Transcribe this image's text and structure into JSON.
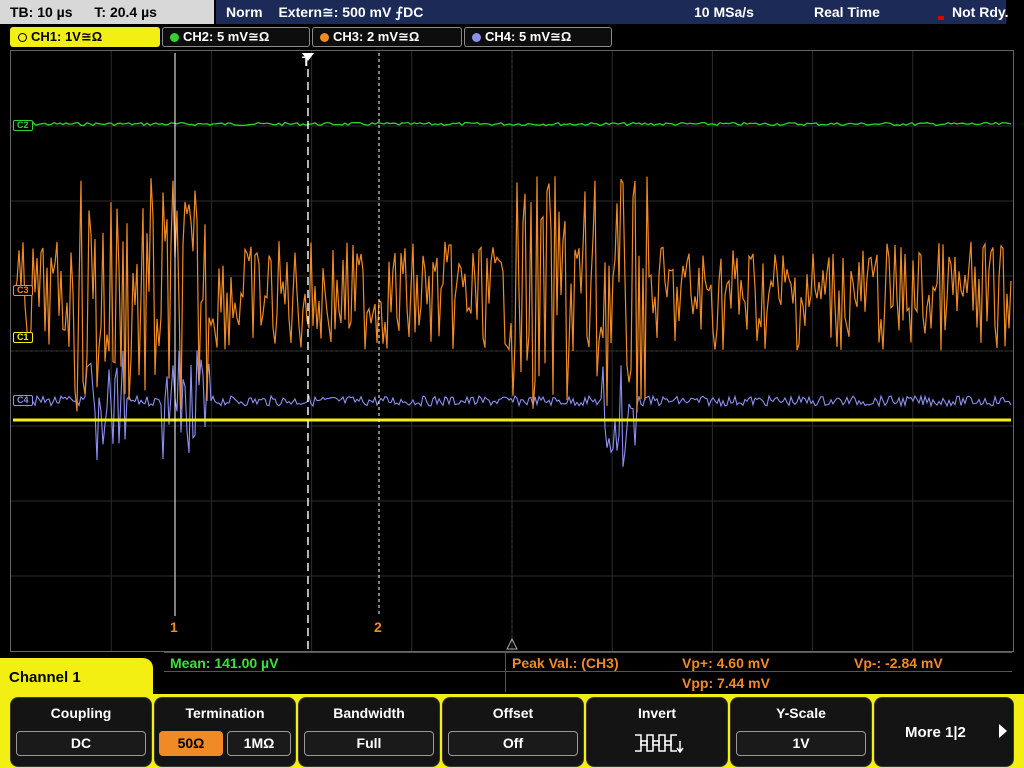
{
  "topbar": {
    "timebase": "TB: 10 µs",
    "trigger_time": "T: 20.4 µs",
    "trigger_mode": "Norm",
    "trigger_source": "Extern≅: 500 mV ⨍DC",
    "sample_rate": "10 MSa/s",
    "acq_mode": "Real Time",
    "status": "Not Rdy."
  },
  "channels": {
    "ch1": {
      "label": "CH1: 1V≅Ω",
      "color": "#f4ef12"
    },
    "ch2": {
      "label": "CH2: 5 mV≅Ω",
      "color": "#2cd62c"
    },
    "ch3": {
      "label": "CH3: 2 mV≅Ω",
      "color": "#f08a24"
    },
    "ch4": {
      "label": "CH4: 5 mV≅Ω",
      "color": "#8c8ff0"
    }
  },
  "waveform": {
    "markers": {
      "c1": "C1",
      "c2": "C2",
      "c3": "C3",
      "c4": "C4"
    },
    "trigger_label": "T",
    "cursor1_label": "1",
    "cursor2_label": "2"
  },
  "measurements": {
    "mean": "Mean: 141.00 µV",
    "peak": "Peak Val.: (CH3)",
    "vp_plus": "Vp+: 4.60 mV",
    "vpp": "Vpp: 7.44 mV",
    "vp_minus": "Vp-: -2.84 mV"
  },
  "panel": {
    "title": "Channel 1",
    "softkeys": {
      "coupling": {
        "title": "Coupling",
        "value": "DC"
      },
      "termination": {
        "title": "Termination",
        "opt1": "50Ω",
        "opt2": "1MΩ"
      },
      "bandwidth": {
        "title": "Bandwidth",
        "value": "Full"
      },
      "offset": {
        "title": "Offset",
        "value": "Off"
      },
      "invert": {
        "title": "Invert"
      },
      "yscale": {
        "title": "Y-Scale",
        "value": "1V"
      },
      "more": {
        "label": "More 1|2"
      }
    }
  }
}
